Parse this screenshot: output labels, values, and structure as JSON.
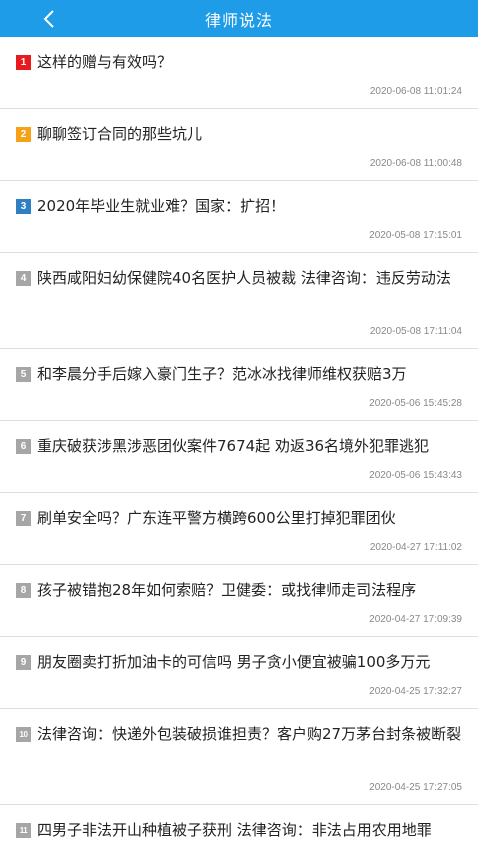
{
  "header": {
    "title": "律师说法",
    "back_icon": "chevron-left-icon"
  },
  "colors": {
    "header": "#1e9ce8",
    "rank1": "#e8191f",
    "rank2": "#f5a218",
    "rank3": "#2e7fc3",
    "rank_other": "#a6a6a6"
  },
  "items": [
    {
      "rank": "1",
      "title": "这样的赠与有效吗？",
      "time": "2020-06-08 11:01:24"
    },
    {
      "rank": "2",
      "title": "聊聊签订合同的那些坑儿",
      "time": "2020-06-08 11:00:48"
    },
    {
      "rank": "3",
      "title": "2020年毕业生就业难？国家：扩招！",
      "time": "2020-05-08 17:15:01"
    },
    {
      "rank": "4",
      "title": "陕西咸阳妇幼保健院40名医护人员被裁 法律咨询：违反劳动法",
      "time": "2020-05-08 17:11:04"
    },
    {
      "rank": "5",
      "title": "和李晨分手后嫁入豪门生子？范冰冰找律师维权获赔3万",
      "time": "2020-05-06 15:45:28"
    },
    {
      "rank": "6",
      "title": "重庆破获涉黑涉恶团伙案件7674起 劝返36名境外犯罪逃犯",
      "time": "2020-05-06 15:43:43"
    },
    {
      "rank": "7",
      "title": "刷单安全吗？广东连平警方横跨600公里打掉犯罪团伙",
      "time": "2020-04-27 17:11:02"
    },
    {
      "rank": "8",
      "title": "孩子被错抱28年如何索赔？卫健委：或找律师走司法程序",
      "time": "2020-04-27 17:09:39"
    },
    {
      "rank": "9",
      "title": "朋友圈卖打折加油卡的可信吗 男子贪小便宜被骗100多万元",
      "time": "2020-04-25 17:32:27"
    },
    {
      "rank": "10",
      "title": "法律咨询：快递外包装破损谁担责？客户购27万茅台封条被断裂",
      "time": "2020-04-25 17:27:05"
    },
    {
      "rank": "11",
      "title": "四男子非法开山种植被子获刑 法律咨询：非法占用农用地罪",
      "time": ""
    }
  ]
}
